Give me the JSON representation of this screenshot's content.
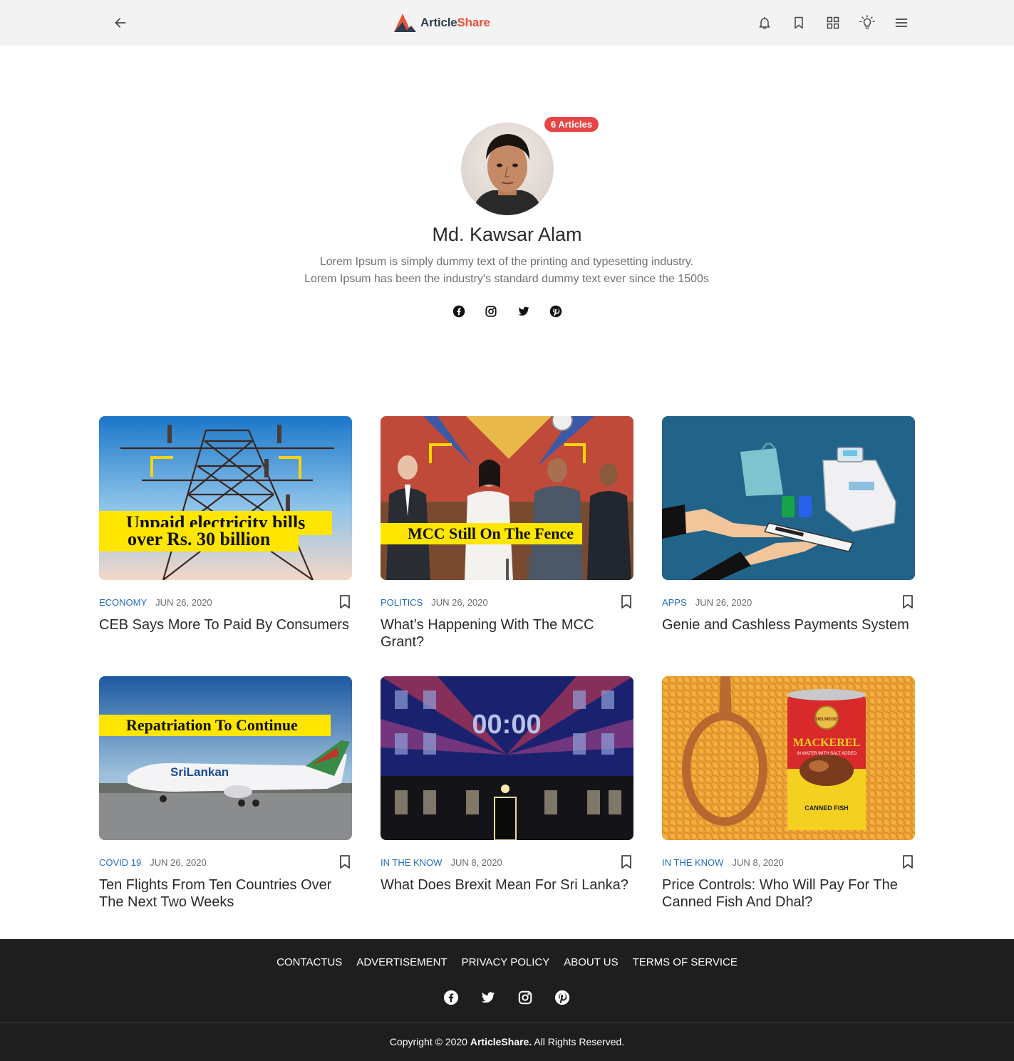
{
  "brand": {
    "name_part1": "Article",
    "name_part2": "Share",
    "accent_dark": "#2d3e50",
    "accent_red": "#e8523a"
  },
  "header": {
    "icons": [
      "back-arrow-icon",
      "bell-icon",
      "bookmark-icon",
      "grid-icon",
      "lightbulb-icon",
      "menu-icon"
    ]
  },
  "profile": {
    "badge": "6 Articles",
    "name": "Md. Kawsar Alam",
    "bio_line1": "Lorem Ipsum is simply dummy text of the printing and typesetting industry.",
    "bio_line2": "Lorem Ipsum has been the industry's standard dummy text ever since the 1500s",
    "socials": [
      "facebook-icon",
      "instagram-icon",
      "twitter-icon",
      "pinterest-icon"
    ]
  },
  "articles": [
    {
      "category": "ECONOMY",
      "date": "JUN 26, 2020",
      "title": "CEB Says More To Paid By Consumers",
      "caption_line1": "Unpaid electricity bills",
      "caption_line2": "over Rs. 30 billion"
    },
    {
      "category": "POLITICS",
      "date": "JUN 26, 2020",
      "title": "What’s Happening With The MCC Grant?",
      "caption": "MCC Still On The Fence"
    },
    {
      "category": "APPS",
      "date": "JUN 26, 2020",
      "title": "Genie and Cashless Payments System"
    },
    {
      "category": "COVID 19",
      "date": "JUN 26, 2020",
      "title": "Ten Flights From Ten Countries Over The Next Two Weeks",
      "caption": "Repatriation To Continue",
      "plane_text": "SriLankan"
    },
    {
      "category": "IN THE KNOW",
      "date": "JUN 8, 2020",
      "title": "What Does Brexit Mean For Sri Lanka?",
      "clock_text": "00:00"
    },
    {
      "category": "IN THE KNOW",
      "date": "JUN 8, 2020",
      "title": "Price Controls: Who Will Pay For The Canned Fish And Dhal?",
      "can_brand": "DELMEGE",
      "can_title": "MACKEREL",
      "can_sub": "IN WATER WITH SALT ADDED",
      "can_bottom": "CANNED FISH"
    }
  ],
  "footer": {
    "links": [
      "CONTACTUS",
      "ADVERTISEMENT",
      "PRIVACY POLICY",
      "ABOUT US",
      "TERMS OF SERVICE"
    ],
    "socials": [
      "facebook-icon",
      "twitter-icon",
      "instagram-icon",
      "pinterest-icon"
    ],
    "copy_prefix": "Copyright © 2020 ",
    "copy_brand": "ArticleShare.",
    "copy_suffix": " All Rights Reserved."
  }
}
